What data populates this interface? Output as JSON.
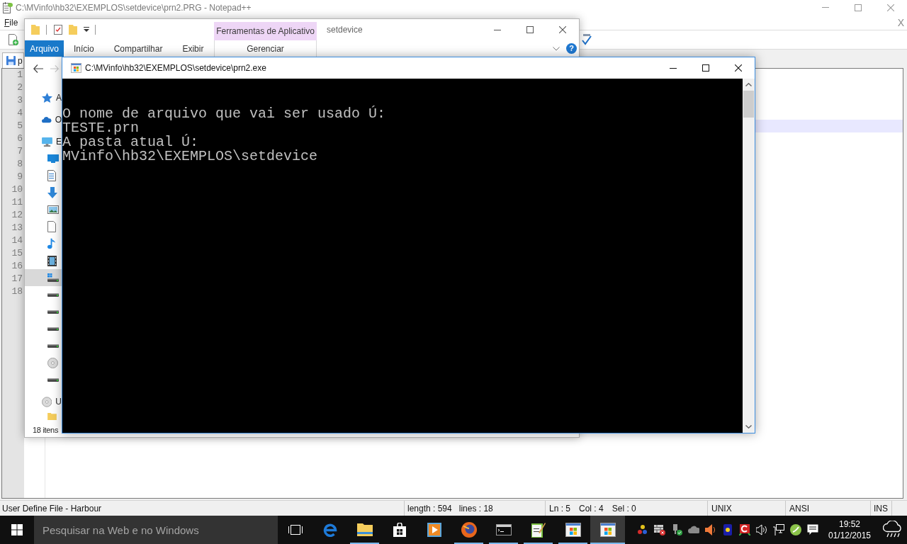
{
  "notepad": {
    "title": "C:\\MVinfo\\hb32\\EXEMPLOS\\setdevice\\prn2.PRG - Notepad++",
    "menu": [
      "File"
    ],
    "close_document": "X",
    "tab": {
      "label": "p"
    },
    "lines": [
      {
        "number": "1",
        "current": false
      },
      {
        "number": "2",
        "current": false
      },
      {
        "number": "3",
        "current": false
      },
      {
        "number": "4",
        "current": false
      },
      {
        "number": "5",
        "current": true
      },
      {
        "number": "6",
        "current": false
      },
      {
        "number": "7",
        "current": false
      },
      {
        "number": "8",
        "current": false
      },
      {
        "number": "9",
        "current": false
      },
      {
        "number": "10",
        "current": false
      },
      {
        "number": "11",
        "current": false
      },
      {
        "number": "12",
        "current": false
      },
      {
        "number": "13",
        "current": false
      },
      {
        "number": "14",
        "current": false
      },
      {
        "number": "15",
        "current": false
      },
      {
        "number": "16",
        "current": false
      },
      {
        "number": "17",
        "current": false
      },
      {
        "number": "18",
        "current": false
      }
    ],
    "status_bar": {
      "language": "User Define File - Harbour",
      "length": "length : 594",
      "lines": "lines : 18",
      "position": [
        "Ln : 5",
        "Col : 4",
        "Sel : 0"
      ],
      "eol": "UNIX",
      "encoding": "ANSI",
      "mode": "INS"
    }
  },
  "explorer": {
    "contextual_group": "Ferramentas de Aplicativo",
    "title": "setdevice",
    "file_tab": "Arquivo",
    "tabs": [
      "Início",
      "Compartilhar",
      "Exibir"
    ],
    "contextual_tabs": [
      "Gerenciar"
    ],
    "help": "?",
    "nav_items": [
      {
        "kind": "quickaccess",
        "label": "A",
        "selected": false
      },
      {
        "kind": "cloud",
        "label": "O",
        "selected": false
      },
      {
        "kind": "computer",
        "label": "E",
        "selected": false
      },
      {
        "kind": "desktop",
        "selected": false
      },
      {
        "kind": "documents",
        "selected": false
      },
      {
        "kind": "downloads",
        "selected": false
      },
      {
        "kind": "pictures",
        "selected": false
      },
      {
        "kind": "file",
        "selected": false
      },
      {
        "kind": "music",
        "selected": false
      },
      {
        "kind": "videos",
        "selected": false
      },
      {
        "kind": "systemdrive",
        "selected": true
      },
      {
        "kind": "drive",
        "selected": false
      },
      {
        "kind": "drive",
        "selected": false
      },
      {
        "kind": "drive",
        "selected": false
      },
      {
        "kind": "drive",
        "selected": false
      },
      {
        "kind": "disc",
        "selected": false
      },
      {
        "kind": "drive",
        "selected": false
      },
      {
        "kind": "disc",
        "label": "U",
        "selected": false
      },
      {
        "kind": "folder",
        "selected": false
      }
    ],
    "status": "18 itens"
  },
  "console": {
    "title": "C:\\MVinfo\\hb32\\EXEMPLOS\\setdevice\\prn2.exe",
    "lines": [
      "O nome de arquivo que vai ser usado Ú:",
      "TESTE.prn",
      "A pasta atual Ú:",
      "MVinfo\\hb32\\EXEMPLOS\\setdevice"
    ]
  },
  "taskbar": {
    "search": {
      "placeholder": "Pesquisar na Web e no Windows"
    },
    "apps": [
      {
        "kind": "taskview",
        "running": false,
        "selected": false
      },
      {
        "kind": "browser",
        "running": false,
        "selected": false
      },
      {
        "kind": "files",
        "running": true,
        "selected": false
      },
      {
        "kind": "store",
        "running": false,
        "selected": false
      },
      {
        "kind": "media",
        "running": false,
        "selected": false
      },
      {
        "kind": "webbrowser",
        "running": true,
        "selected": false
      },
      {
        "kind": "terminal",
        "running": true,
        "selected": false
      },
      {
        "kind": "editor",
        "running": true,
        "selected": false
      },
      {
        "kind": "program",
        "running": true,
        "selected": false
      },
      {
        "kind": "program",
        "running": true,
        "selected": true
      }
    ],
    "clock": {
      "time": "19:52",
      "date": "01/12/2015"
    }
  }
}
